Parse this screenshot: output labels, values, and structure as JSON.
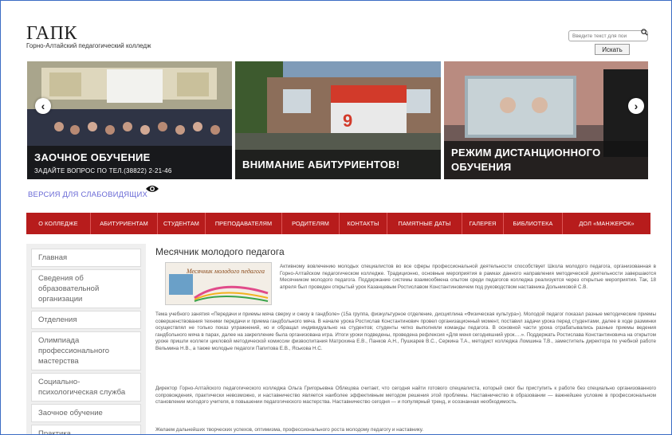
{
  "header": {
    "title": "ГАПК",
    "subtitle": "Горно-Алтайский педагогический колледж",
    "search_placeholder": "Введите текст для пои",
    "search_button": "Искать"
  },
  "slider": {
    "slides": [
      {
        "title": "ЗАОЧНОЕ ОБУЧЕНИЕ",
        "subtitle": "ЗАДАЙТЕ ВОПРОС ПО ТЕЛ.(38822) 2-21-46"
      },
      {
        "title": "ВНИМАНИЕ АБИТУРИЕНТОВ!",
        "subtitle": ""
      },
      {
        "title": "РЕЖИМ ДИСТАНЦИОННОГО ОБУЧЕНИЯ",
        "subtitle": ""
      }
    ],
    "prev_icon": "chevron-left-icon",
    "next_icon": "chevron-right-icon",
    "billboard_number": "9"
  },
  "low_vision": {
    "label": "ВЕРСИЯ ДЛЯ СЛАБОВИДЯЩИХ",
    "icon": "eye-icon"
  },
  "nav": {
    "items": [
      "О КОЛЛЕДЖЕ",
      "АБИТУРИЕНТАМ",
      "СТУДЕНТАМ",
      "ПРЕПОДАВАТЕЛЯМ",
      "РОДИТЕЛЯМ",
      "КОНТАКТЫ",
      "ПАМЯТНЫЕ ДАТЫ",
      "ГАЛЕРЕЯ",
      "БИБЛИОТЕКА",
      "ДОЛ «МАНЖЕРОК»"
    ],
    "color": "#b71c1c"
  },
  "sidebar": {
    "items": [
      "Главная",
      "Сведения об образовательной организации",
      "Отделения",
      "Олимпиада профессионального мастерства",
      "Социально-психологическая служба",
      "Заочное обучение",
      "Практика"
    ]
  },
  "article": {
    "title": "Месячник молодого педагога",
    "image_caption": "Месячник молодого педагога",
    "p1": "Активному вовлечению молодых специалистов во все сферы профессиональной деятельности способствует Школа молодого педагога, организованная в Горно-Алтайском педагогическом колледже. Традиционно, основные мероприятия в рамках данного направления методической деятельности завершаются Месячником молодого педагога. Поддержание системы взаимообмена опытом среди педагогов колледжа реализуется через открытые мероприятия. Так, 18 апреля был проведен открытый урок Казанцевым Ростиславом Константиновичем под руководством наставника Дольниковой С.В.",
    "p2": "Тема учебного занятия «Передачи и приемы мяча сверху и снизу в гандболе» (15а группа, физкультурное отделение, дисциплина «Физическая культура»). Молодой педагог показал разные методические приемы совершенствования техники передачи и приема гандбольного мяча. В начале урока Ростислав Константинович провел организационный момент, поставил задачи урока перед студентами, далее в ходе разминки осуществлял не только показ упражнений, но и обращал индивидуально на студентов; студенты четко выполняли команды педагога. В основной части урока отрабатывались разные приемы ведения гандбольного мяча в парах, далее на закрепление была организована игра. Итоги уроки подведены, проведена рефлексия «Для меня сегодняшний урок….». Поддержать Ростислава Константиновича на открытом уроке пришли коллеги цикловой методической комиссии физвоспитания Матрохина Е.В., Панков А.Н., Пушкарев В.С., Серкина Т.А., методист колледжа Ломшина Т.В., заместитель директора по учебной работе Вельмина Н.В., а также молодые педагоги Папитова Е.В., Яськова Н.С.",
    "p3": "Директор Горно-Алтайского педагогического колледжа Ольга Григорьевна Облецова считает, что сегодня найти готового специалиста, который смог бы приступить к работе без специально организованного сопровождения, практически невозможно, и наставничество является наиболее эффективным методом решения этой проблемы. Наставничество в образовании — важнейшее условие в профессиональном становлении молодого учителя, в повышении педагогического мастерства. Наставничество сегодня — и популярный тренд, и осознанная необходимость.",
    "p4": "Желаем дальнейших творческих успехов, оптимизма, профессионального роста молодому педагогу и наставнику."
  }
}
